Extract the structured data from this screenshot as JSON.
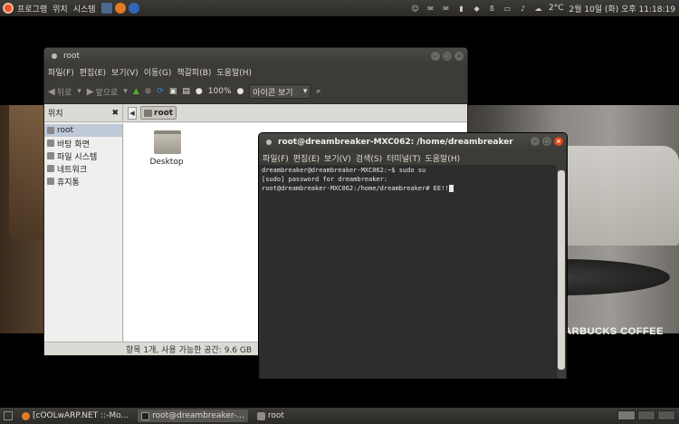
{
  "top_panel": {
    "menus": [
      "프로그램",
      "위치",
      "시스템"
    ],
    "temperature": "2°C",
    "clock": "2월 10일 (화) 오후 11:18:19"
  },
  "desktop": {
    "brand": "STARBUCKS COFFEE"
  },
  "file_manager": {
    "title": "root",
    "menu": [
      "파일(F)",
      "편집(E)",
      "보기(V)",
      "이동(G)",
      "책갈피(B)",
      "도움말(H)"
    ],
    "toolbar": {
      "back": "뒤로",
      "forward": "앞으로",
      "zoom": "100%",
      "view": "아이콘 보기"
    },
    "location_label": "위치",
    "breadcrumb": "root",
    "sidebar": [
      "root",
      "바탕 화면",
      "파일 시스템",
      "네트워크",
      "휴지통"
    ],
    "items": [
      "Desktop"
    ],
    "status": "항목 1개, 사용 가능한 공간: 9.6 GB"
  },
  "terminal": {
    "title": "root@dreambreaker-MXC062: /home/dreambreaker",
    "menu": [
      "파일(F)",
      "편집(E)",
      "보기(V)",
      "검색(S)",
      "터미널(T)",
      "도움말(H)"
    ],
    "lines": [
      "dreambreaker@dreambreaker-MXC062:~$ sudo su",
      "[sudo] password for dreambreaker:",
      "root@dreambreaker-MXC062:/home/dreambreaker# EE!!"
    ]
  },
  "bottom_panel": {
    "tasks": [
      "[cOOLwARP.NET ::-Mo...",
      "root@dreambreaker-...",
      "root"
    ]
  }
}
